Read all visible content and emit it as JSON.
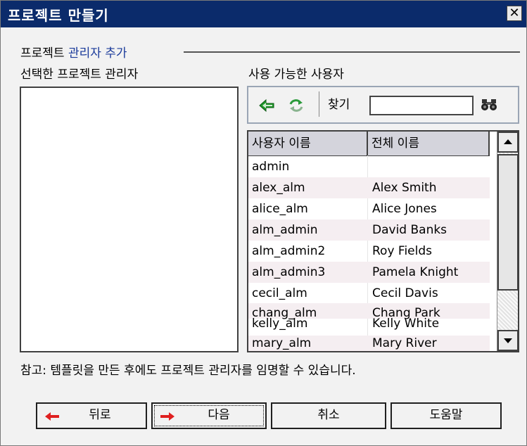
{
  "window": {
    "title": "프로젝트 만들기",
    "close_glyph": "✕"
  },
  "section": {
    "title_prefix": "프로젝트 ",
    "title_accent": "관리자 추가"
  },
  "left_panel": {
    "label": "선택한 프로젝트 관리자"
  },
  "right_panel": {
    "label": "사용 가능한 사용자",
    "toolbar": {
      "add_icon": "green-left-arrow-icon",
      "refresh_icon": "refresh-icon",
      "find_label": "찾기",
      "find_value": "",
      "search_icon": "binoculars-icon"
    },
    "table": {
      "columns": [
        "사용자 이름",
        "전체 이름"
      ],
      "rows": [
        [
          "admin",
          ""
        ],
        [
          "alex_alm",
          "Alex Smith"
        ],
        [
          "alice_alm",
          "Alice Jones"
        ],
        [
          "alm_admin",
          "David Banks"
        ],
        [
          "alm_admin2",
          "Roy Fields"
        ],
        [
          "alm_admin3",
          "Pamela Knight"
        ],
        [
          "cecil_alm",
          "Cecil Davis"
        ],
        [
          "chang_alm",
          "Chang Park"
        ],
        [
          "kelly_alm",
          "Kelly White"
        ],
        [
          "mary_alm",
          "Mary River"
        ]
      ]
    }
  },
  "note": "참고: 템플릿을 만든 후에도 프로젝트 관리자를 임명할 수 있습니다.",
  "buttons": {
    "back": "뒤로",
    "next": "다음",
    "cancel": "취소",
    "help": "도움말"
  },
  "colors": {
    "titlebar": "#0b2b6b",
    "accent": "#1a3a9a",
    "arrow_red": "#e02020",
    "arrow_green": "#1f9a2a",
    "row_alt": "#f5eef1",
    "header_bg": "#d4d4dc"
  }
}
